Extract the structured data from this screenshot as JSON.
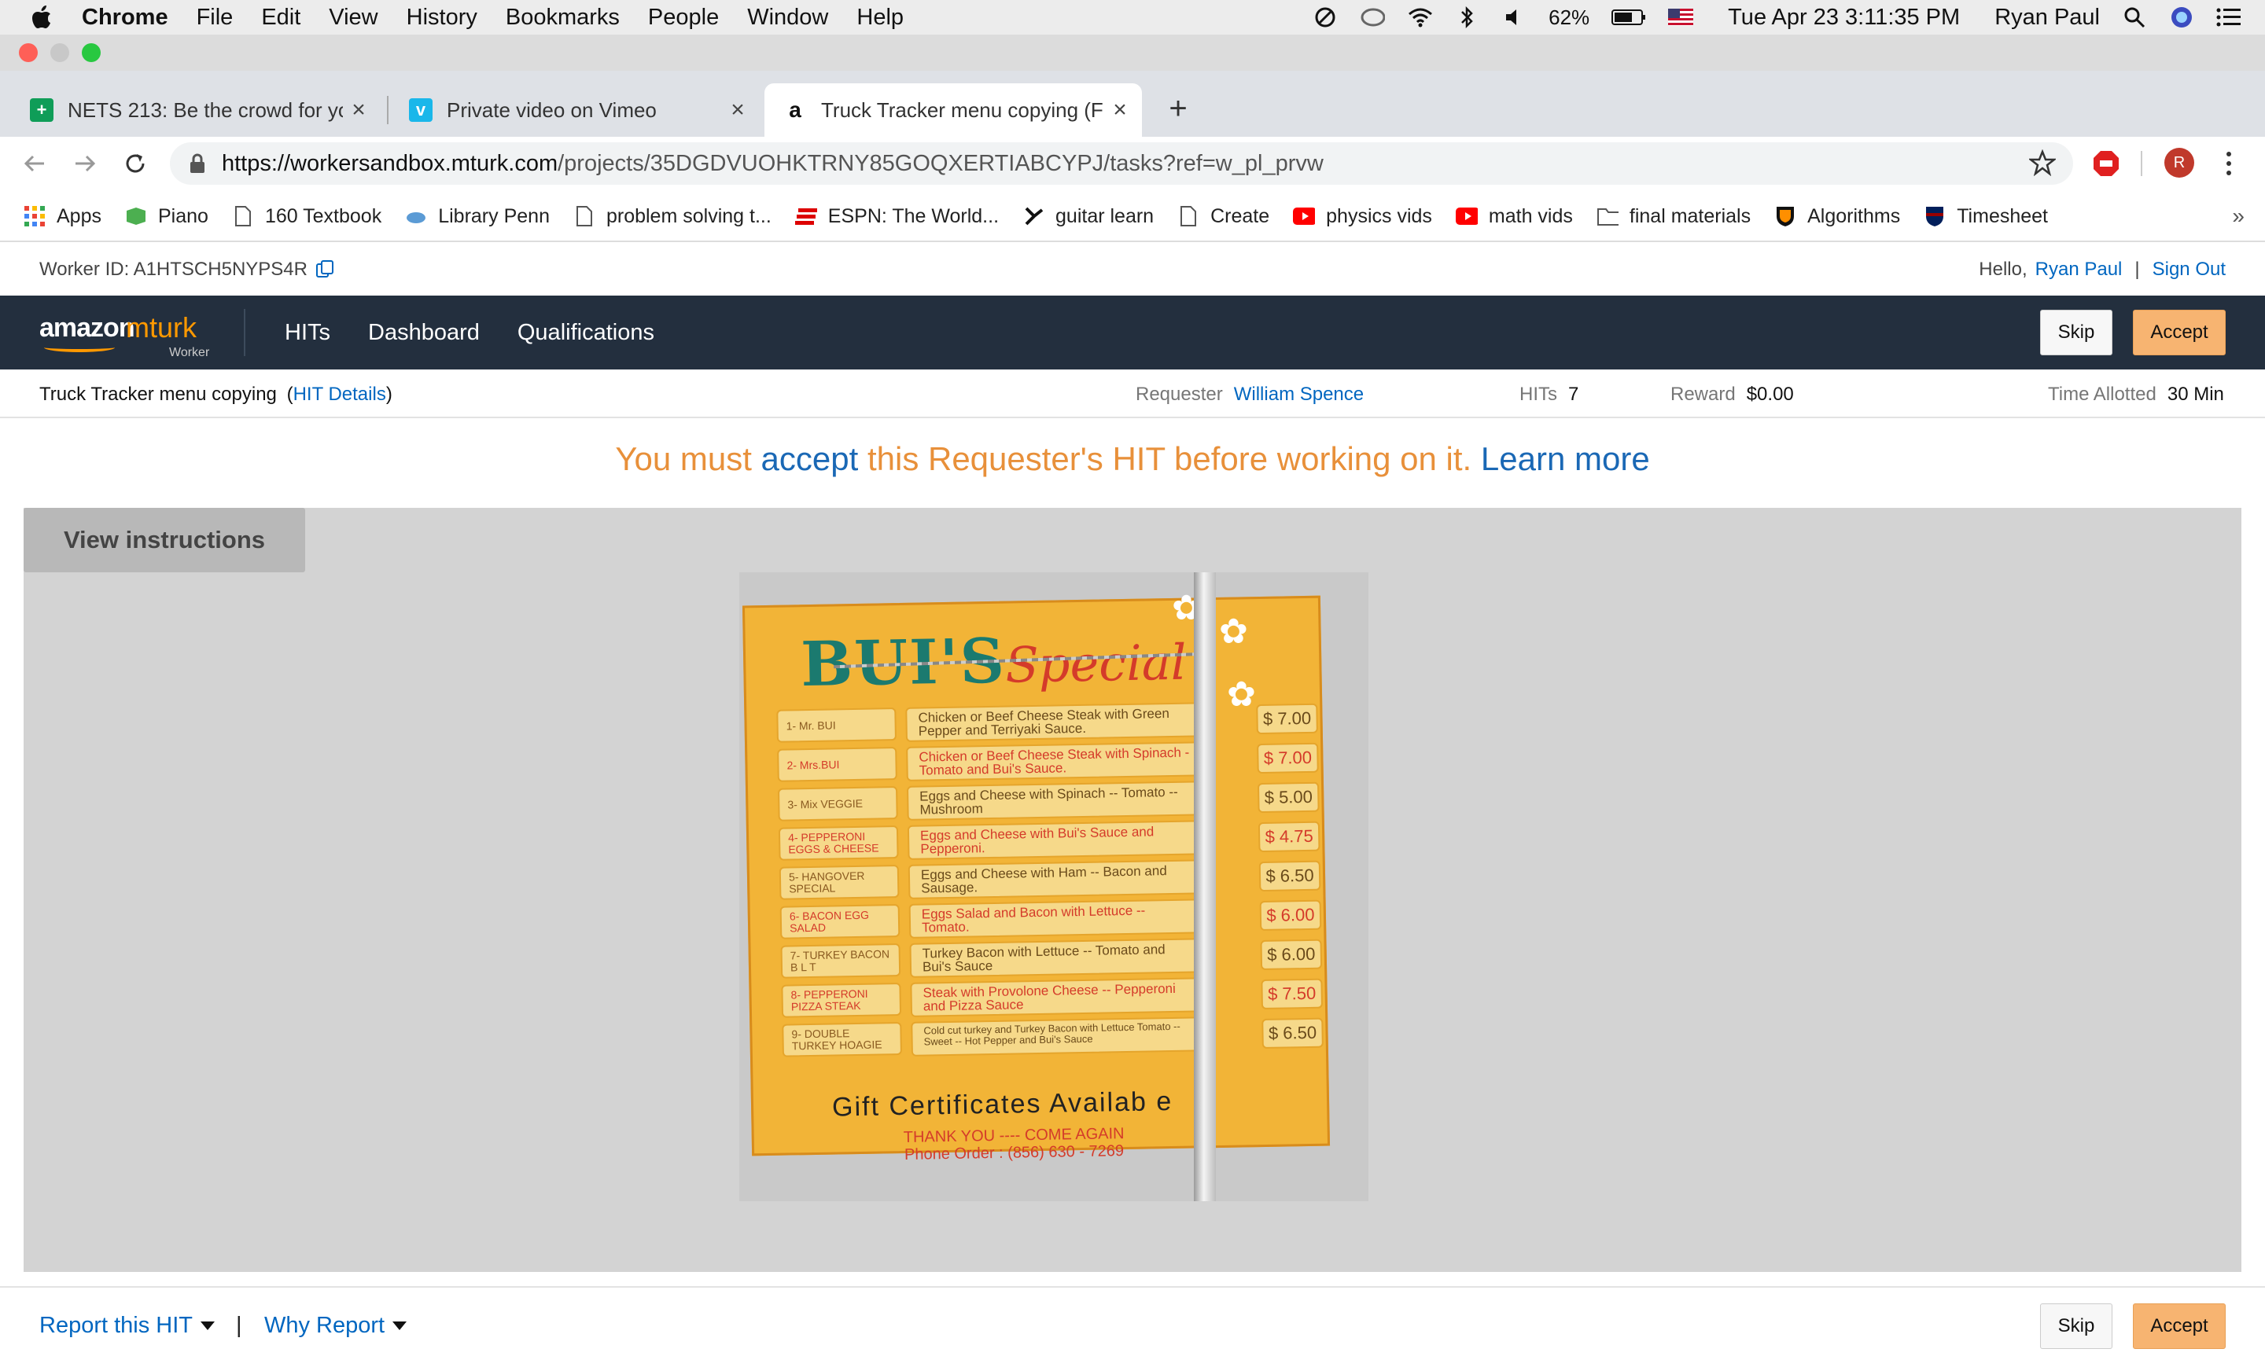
{
  "menubar": {
    "app": "Chrome",
    "items": [
      "File",
      "Edit",
      "View",
      "History",
      "Bookmarks",
      "People",
      "Window",
      "Help"
    ],
    "battery": "62%",
    "datetime": "Tue Apr 23  3:11:35 PM",
    "user": "Ryan Paul"
  },
  "tabs": [
    {
      "title": "NETS 213: Be the crowd for yo",
      "icon": "sheets-icon",
      "color": "#0f9d58"
    },
    {
      "title": "Private video on Vimeo",
      "icon": "vimeo-icon",
      "color": "#1ab7ea"
    },
    {
      "title": "Truck Tracker menu copying (F",
      "icon": "amazon-icon",
      "color": "#ffffff"
    }
  ],
  "url": {
    "domain": "https://workersandbox.mturk.com",
    "path": "/projects/35DGDVUOHKTRNY85GOQXERTIABCYPJ/tasks?ref=w_pl_prvw"
  },
  "profile_initial": "R",
  "bookmarks": [
    "Apps",
    "Piano",
    "160 Textbook",
    "Library Penn",
    "problem solving t...",
    "ESPN: The World...",
    "guitar learn",
    "Create",
    "physics vids",
    "math vids",
    "final materials",
    "Algorithms",
    "Timesheet"
  ],
  "worker": {
    "id_text": "Worker ID: A1HTSCH5NYPS4R",
    "hello": "Hello,",
    "name": "Ryan Paul",
    "sep": "|",
    "signout": "Sign Out"
  },
  "nav": {
    "logo_amazon": "amazon",
    "logo_mturk": "mturk",
    "logo_worker": "Worker",
    "links": [
      "HITs",
      "Dashboard",
      "Qualifications"
    ],
    "skip": "Skip",
    "accept": "Accept"
  },
  "hit": {
    "title": "Truck Tracker menu copying",
    "details_open": "(",
    "details": "HIT Details",
    "details_close": ")",
    "requester_label": "Requester",
    "requester": "William Spence",
    "hits_label": "HITs",
    "hits": "7",
    "reward_label": "Reward",
    "reward": "$0.00",
    "time_label": "Time Allotted",
    "time": "30 Min"
  },
  "banner": {
    "p1": "You must ",
    "accept": "accept",
    "p2": " this Requester's HIT before working on it. ",
    "learn": "Learn more"
  },
  "view_instructions": "View instructions",
  "sign": {
    "title": "BUI'S",
    "subtitle": "Special",
    "rows": [
      {
        "name": "1- Mr. BUI",
        "desc": "Chicken or Beef Cheese Steak with Green Pepper and Terriyaki Sauce.",
        "price": "$ 7.00",
        "red": false
      },
      {
        "name": "2- Mrs.BUI",
        "desc": "Chicken or Beef Cheese Steak with Spinach - Tomato and Bui's Sauce.",
        "price": "$ 7.00",
        "red": true
      },
      {
        "name": "3- Mix VEGGIE",
        "desc": "Eggs and Cheese with Spinach -- Tomato -- Mushroom",
        "price": "$ 5.00",
        "red": false
      },
      {
        "name": "4- PEPPERONI EGGS & CHEESE",
        "desc": "Eggs and Cheese  with Bui's Sauce and Pepperoni.",
        "price": "$ 4.75",
        "red": true
      },
      {
        "name": "5- HANGOVER SPECIAL",
        "desc": "Eggs and Cheese with Ham -- Bacon and Sausage.",
        "price": "$ 6.50",
        "red": false
      },
      {
        "name": "6- BACON EGG SALAD",
        "desc": "Eggs Salad and Bacon with Lettuce -- Tomato.",
        "price": "$ 6.00",
        "red": true
      },
      {
        "name": "7- TURKEY BACON B L T",
        "desc": "Turkey Bacon with Lettuce -- Tomato and Bui's Sauce",
        "price": "$ 6.00",
        "red": false
      },
      {
        "name": "8- PEPPERONI PIZZA STEAK",
        "desc": "Steak with Provolone Cheese -- Pepperoni and Pizza Sauce",
        "price": "$ 7.50",
        "red": true
      },
      {
        "name": "9- DOUBLE TURKEY HOAGIE",
        "desc": "Cold cut turkey and Turkey Bacon with Lettuce Tomato -- Sweet -- Hot Pepper and Bui's Sauce",
        "price": "$ 6.50",
        "red": false
      }
    ],
    "footer": "Gift Certificates Availab e",
    "thanks": "THANK YOU  ----  COME AGAIN",
    "phone": "Phone Order : (856) 630 - 7269"
  },
  "footer": {
    "report": "Report this HIT",
    "sep": "|",
    "why": "Why Report",
    "skip": "Skip",
    "accept": "Accept"
  }
}
